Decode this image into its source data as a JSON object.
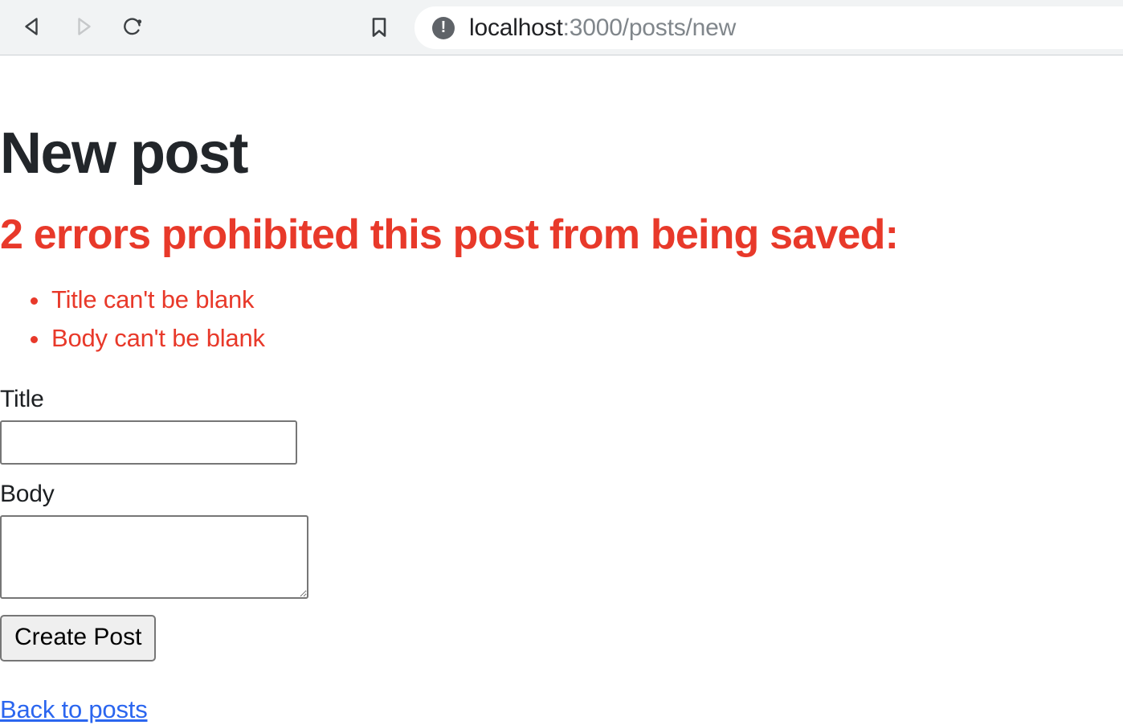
{
  "browser": {
    "back_label": "Back",
    "forward_label": "Forward",
    "reload_label": "Reload this page",
    "bookmark_label": "Bookmark this tab",
    "site_info_label": "Not secure",
    "site_info_glyph": "!",
    "url_host": "localhost",
    "url_path": ":3000/posts/new",
    "url_full": "localhost:3000/posts/new"
  },
  "page": {
    "title": "New post",
    "errors": {
      "heading": "2 errors prohibited this post from being saved:",
      "items": [
        "Title can't be blank",
        "Body can't be blank"
      ]
    },
    "form": {
      "title_label": "Title",
      "title_value": "",
      "body_label": "Body",
      "body_value": "",
      "submit_label": "Create Post"
    },
    "back_link": "Back to posts"
  },
  "colors": {
    "error": "#e8392a",
    "link": "#2b66ef",
    "heading": "#22262a",
    "toolbar_bg": "#f1f3f4",
    "field_border": "#767676",
    "button_bg": "#efefef"
  }
}
